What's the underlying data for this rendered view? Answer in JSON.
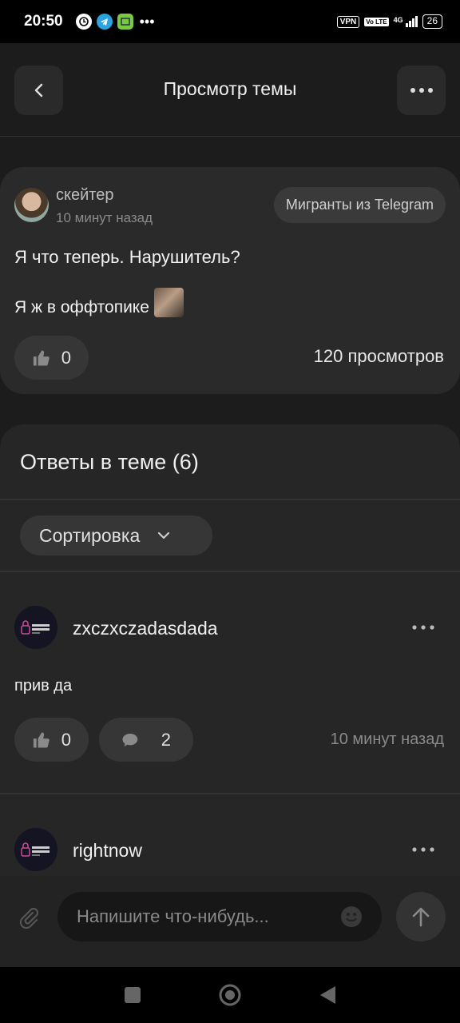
{
  "status_bar": {
    "time": "20:50",
    "vpn": "VPN",
    "volte": "Vo LTE",
    "network": "4G",
    "battery": "26"
  },
  "header": {
    "title": "Просмотр темы"
  },
  "post": {
    "author": "скейтер",
    "time": "10 минут назад",
    "tag": "Мигранты из Telegram",
    "title": "Я что теперь. Нарушитель?",
    "body": "Я ж в оффтопике",
    "likes": "0",
    "views": "120 просмотров"
  },
  "replies": {
    "title": "Ответы в теме (6)",
    "sort_label": "Сортировка",
    "items": [
      {
        "author": "zxczxczadasdada",
        "text": "прив да",
        "likes": "0",
        "comments": "2",
        "time": "10 минут назад"
      },
      {
        "author": "rightnow"
      }
    ]
  },
  "composer": {
    "placeholder": "Напишите что-нибудь..."
  },
  "colors": {
    "background": "#1c1c1c",
    "card": "#2a2a2a",
    "pill": "#363636"
  }
}
